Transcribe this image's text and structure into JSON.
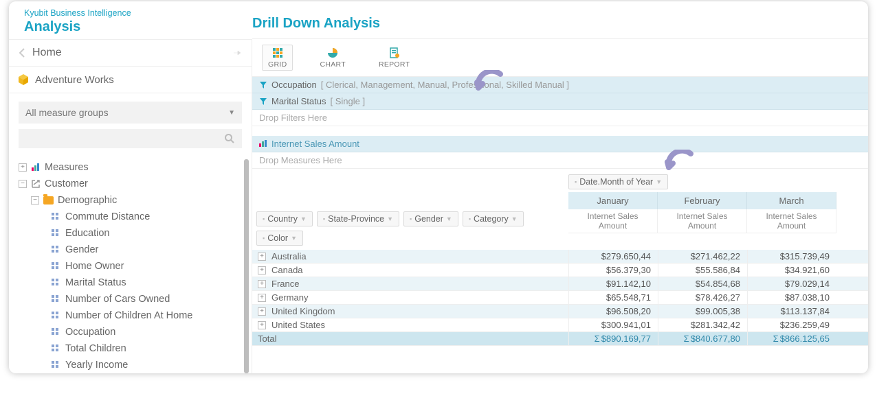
{
  "header": {
    "product": "Kyubit Business Intelligence",
    "title": "Analysis"
  },
  "page": {
    "title": "Drill Down Analysis"
  },
  "sidebar": {
    "home": "Home",
    "cube": "Adventure Works",
    "dropdown": "All measure groups",
    "nodes": {
      "measures": "Measures",
      "customer": "Customer",
      "demographic": "Demographic",
      "attrs": [
        "Commute Distance",
        "Education",
        "Gender",
        "Home Owner",
        "Marital Status",
        "Number of Cars Owned",
        "Number of Children At Home",
        "Occupation",
        "Total Children",
        "Yearly Income"
      ]
    }
  },
  "toolbar": {
    "grid": "GRID",
    "chart": "CHART",
    "report": "REPORT"
  },
  "filters": [
    {
      "name": "Occupation",
      "values": "[ Clerical, Management, Manual, Professional, Skilled Manual ]"
    },
    {
      "name": "Marital Status",
      "values": "[ Single ]"
    }
  ],
  "drop_filters": "Drop Filters Here",
  "measure": "Internet Sales Amount",
  "drop_measures": "Drop Measures Here",
  "col_dim": "Date.Month of Year",
  "row_dims": [
    "Country",
    "State-Province",
    "Gender",
    "Category",
    "Color"
  ],
  "months": [
    "January",
    "February",
    "March"
  ],
  "measure_label": "Internet Sales Amount",
  "rows": [
    {
      "label": "Australia",
      "vals": [
        "$279.650,44",
        "$271.462,22",
        "$315.739,49"
      ]
    },
    {
      "label": "Canada",
      "vals": [
        "$56.379,30",
        "$55.586,84",
        "$34.921,60"
      ]
    },
    {
      "label": "France",
      "vals": [
        "$91.142,10",
        "$54.854,68",
        "$79.029,14"
      ]
    },
    {
      "label": "Germany",
      "vals": [
        "$65.548,71",
        "$78.426,27",
        "$87.038,10"
      ]
    },
    {
      "label": "United Kingdom",
      "vals": [
        "$96.508,20",
        "$99.005,38",
        "$113.137,84"
      ]
    },
    {
      "label": "United States",
      "vals": [
        "$300.941,01",
        "$281.342,42",
        "$236.259,49"
      ]
    }
  ],
  "total": {
    "label": "Total",
    "vals": [
      "$890.169,77",
      "$840.677,80",
      "$866.125,65"
    ]
  },
  "sigma": "Σ"
}
